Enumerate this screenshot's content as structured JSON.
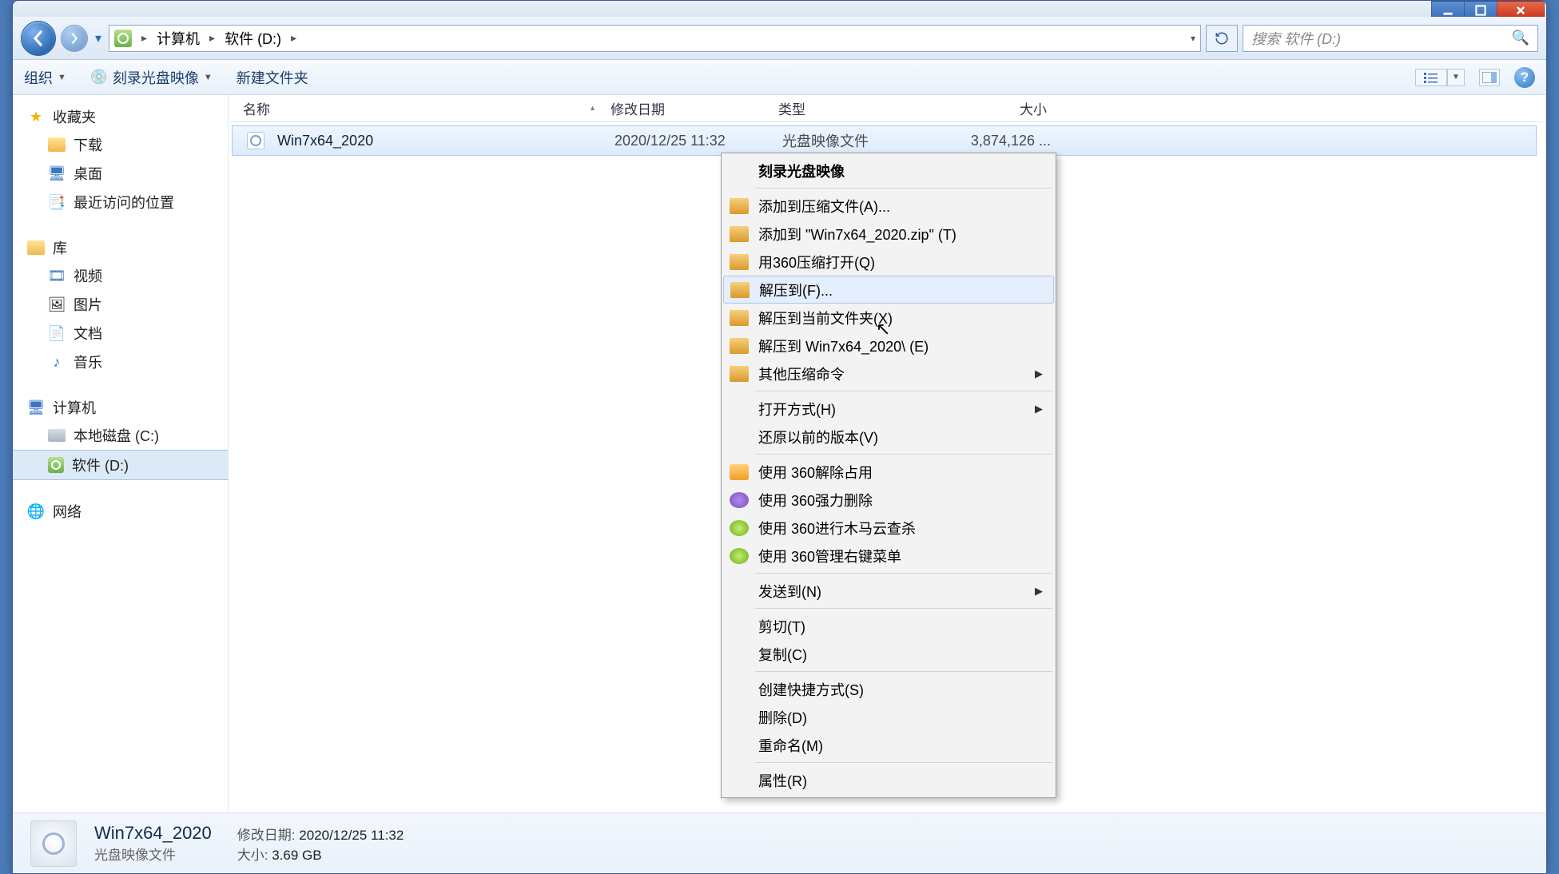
{
  "breadcrumb": {
    "root": "计算机",
    "current": "软件 (D:)"
  },
  "search": {
    "placeholder": "搜索 软件 (D:)"
  },
  "toolbar": {
    "organize": "组织",
    "burn": "刻录光盘映像",
    "newfolder": "新建文件夹"
  },
  "columns": {
    "name": "名称",
    "date": "修改日期",
    "type": "类型",
    "size": "大小"
  },
  "file": {
    "name": "Win7x64_2020",
    "date": "2020/12/25 11:32",
    "type": "光盘映像文件",
    "size": "3,874,126 ..."
  },
  "sidebar": {
    "favorites": "收藏夹",
    "downloads": "下载",
    "desktop": "桌面",
    "recent": "最近访问的位置",
    "libraries": "库",
    "videos": "视频",
    "pictures": "图片",
    "documents": "文档",
    "music": "音乐",
    "computer": "计算机",
    "localc": "本地磁盘 (C:)",
    "soft": "软件 (D:)",
    "network": "网络"
  },
  "ctx": {
    "burn": "刻录光盘映像",
    "addArchive": "添加到压缩文件(A)...",
    "addZip": "添加到 \"Win7x64_2020.zip\" (T)",
    "openWith360": "用360压缩打开(Q)",
    "extractTo": "解压到(F)...",
    "extractHere": "解压到当前文件夹(X)",
    "extractNamed": "解压到 Win7x64_2020\\ (E)",
    "otherZip": "其他压缩命令",
    "openWith": "打开方式(H)",
    "restore": "还原以前的版本(V)",
    "unlock360": "使用 360解除占用",
    "forceDel360": "使用 360强力删除",
    "trojan360": "使用 360进行木马云查杀",
    "menu360": "使用 360管理右键菜单",
    "sendTo": "发送到(N)",
    "cut": "剪切(T)",
    "copy": "复制(C)",
    "shortcut": "创建快捷方式(S)",
    "delete": "删除(D)",
    "rename": "重命名(M)",
    "props": "属性(R)"
  },
  "details": {
    "title": "Win7x64_2020",
    "type": "光盘映像文件",
    "dateLabel": "修改日期:",
    "date": "2020/12/25 11:32",
    "sizeLabel": "大小:",
    "size": "3.69 GB"
  }
}
